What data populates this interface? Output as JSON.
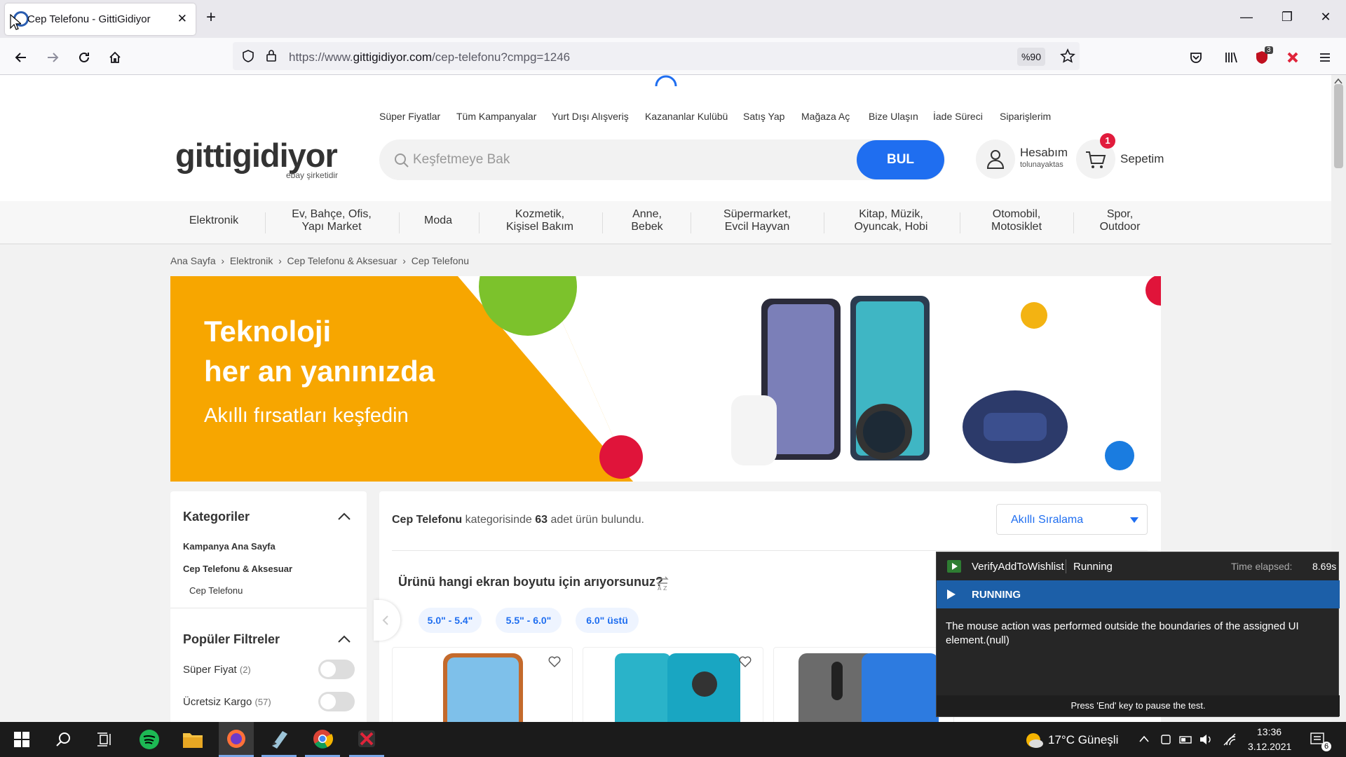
{
  "browser": {
    "tab_title": "Cep Telefonu - GittiGidiyor",
    "url_prefix": "https://www.",
    "url_domain": "gittigidiyor.com",
    "url_path": "/cep-telefonu?cmpg=1246",
    "zoom": "%90",
    "ext_badge": "3"
  },
  "site": {
    "logo": "gittigidiyor",
    "logo_sub": "ebay şirketidir",
    "top_links": [
      "Süper Fiyatlar",
      "Tüm Kampanyalar",
      "Yurt Dışı Alışveriş",
      "Kazananlar Kulübü",
      "Satış Yap",
      "Mağaza Aç",
      "Bize Ulaşın",
      "İade Süreci",
      "Siparişlerim"
    ],
    "search_placeholder": "Keşfetmeye Bak",
    "search_button": "BUL",
    "account_label": "Hesabım",
    "account_user": "tolunayaktas",
    "cart_label": "Sepetim",
    "cart_count": "1"
  },
  "categories": [
    {
      "l1": "Elektronik",
      "l2": ""
    },
    {
      "l1": "Ev, Bahçe, Ofis,",
      "l2": "Yapı Market"
    },
    {
      "l1": "Moda",
      "l2": ""
    },
    {
      "l1": "Kozmetik,",
      "l2": "Kişisel Bakım"
    },
    {
      "l1": "Anne,",
      "l2": "Bebek"
    },
    {
      "l1": "Süpermarket,",
      "l2": "Evcil Hayvan"
    },
    {
      "l1": "Kitap, Müzik,",
      "l2": "Oyuncak, Hobi"
    },
    {
      "l1": "Otomobil,",
      "l2": "Motosiklet"
    },
    {
      "l1": "Spor,",
      "l2": "Outdoor"
    }
  ],
  "breadcrumb": [
    "Ana Sayfa",
    "Elektronik",
    "Cep Telefonu & Aksesuar",
    "Cep Telefonu"
  ],
  "banner": {
    "line1": "Teknoloji",
    "line2": "her an yanınızda",
    "line3": "Akıllı fırsatları keşfedin"
  },
  "sidebar": {
    "categories_title": "Kategoriler",
    "cat_items": [
      "Kampanya Ana Sayfa",
      "Cep Telefonu & Aksesuar",
      "Cep Telefonu"
    ],
    "filters_title": "Popüler Filtreler",
    "filters": [
      {
        "label": "Süper Fiyat",
        "count": "(2)"
      },
      {
        "label": "Ücretsiz Kargo",
        "count": "(57)"
      }
    ]
  },
  "results": {
    "category": "Cep Telefonu",
    "text_mid": " kategorisinde ",
    "count": "63",
    "text_end": " adet ürün bulundu.",
    "sort_label": "Akıllı Sıralama",
    "question": "Ürünü hangi ekran boyutu için arıyorsunuz?",
    "chips": [
      "5.0\" - 5.4\"",
      "5.5\" - 6.0\"",
      "6.0\" üstü"
    ]
  },
  "runner": {
    "test_name": "VerifyAddToWishlist",
    "status": "Running",
    "elapsed_label": "Time elapsed:",
    "elapsed": "8.69s",
    "bar_label": "RUNNING",
    "message": "The mouse action was performed outside the boundaries of the assigned UI element.(null)",
    "footer": "Press 'End' key to pause the test."
  },
  "taskbar": {
    "weather": "17°C  Güneşli",
    "time": "13:36",
    "date": "3.12.2021",
    "notif_count": "6"
  }
}
